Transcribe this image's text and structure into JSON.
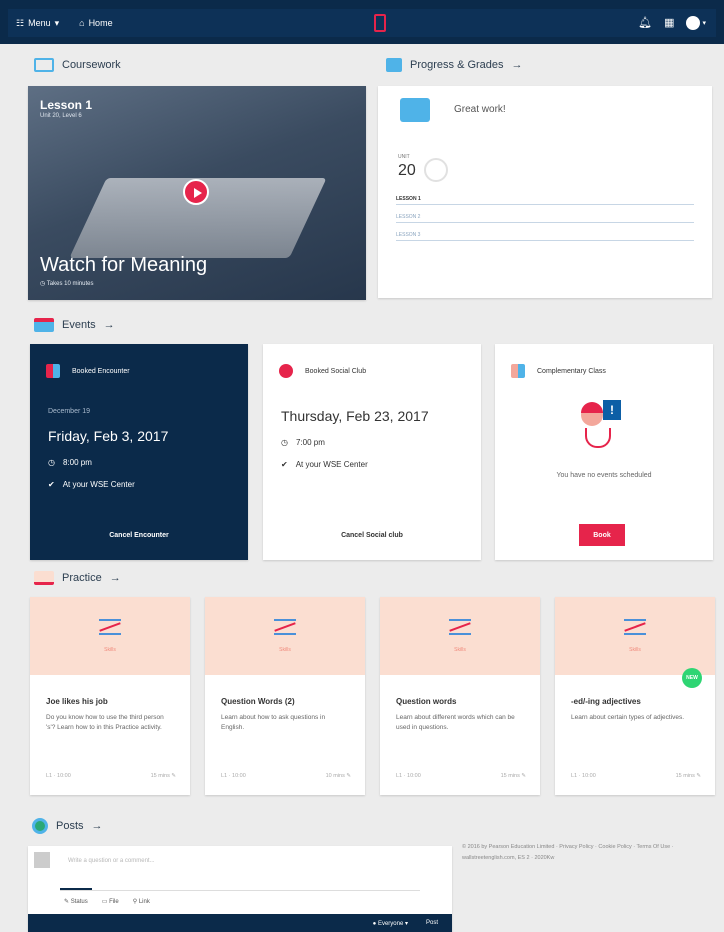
{
  "topbar": {
    "menu": "Menu",
    "home": "Home"
  },
  "sections": {
    "coursework": "Coursework",
    "progress": "Progress & Grades",
    "events": "Events",
    "practice": "Practice",
    "posts": "Posts"
  },
  "coursework": {
    "lesson": "Lesson 1",
    "unit_line": "Unit 20, Level 6",
    "title": "Watch for Meaning",
    "duration": "Takes 10 minutes"
  },
  "progress": {
    "message": "Great work!",
    "unit_label": "UNIT",
    "unit_number": "20",
    "lessons": [
      "LESSON 1",
      "LESSON 2",
      "LESSON 3"
    ]
  },
  "events": [
    {
      "name": "Booked Encounter",
      "date_small": "December 19",
      "date": "Friday, Feb 3, 2017",
      "time": "8:00 pm",
      "location": "At your WSE Center",
      "action": "Cancel Encounter"
    },
    {
      "name": "Booked Social Club",
      "date": "Thursday, Feb 23, 2017",
      "time": "7:00 pm",
      "location": "At your WSE Center",
      "action": "Cancel Social club"
    },
    {
      "name": "Complementary Class",
      "message": "You have no events scheduled",
      "action": "Book"
    }
  ],
  "practice": [
    {
      "sub": "Skills",
      "title": "Joe likes his job",
      "desc": "Do you know how to use the third person 's'? Learn how to in this Practice activity.",
      "meta": "L1 · 10:00",
      "time": "15 mins"
    },
    {
      "sub": "Skills",
      "title": "Question Words (2)",
      "desc": "Learn about how to ask questions in English.",
      "meta": "L1 · 10:00",
      "time": "10 mins"
    },
    {
      "sub": "Skills",
      "title": "Question words",
      "desc": "Learn about different words which can be used in questions.",
      "meta": "L1 · 10:00",
      "time": "15 mins"
    },
    {
      "sub": "Skills",
      "title": "-ed/-ing adjectives",
      "desc": "Learn about certain types of adjectives.",
      "meta": "L1 · 10:00",
      "time": "15 mins"
    }
  ],
  "practice_badge": "NEW",
  "posts": {
    "placeholder": "Write a question or a comment...",
    "tabs": [
      "Status",
      "File",
      "Link"
    ],
    "audience": "Everyone",
    "post_btn": "Post"
  },
  "footer": "© 2016 by Pearson Education Limited · Privacy Policy · Cookie Policy · Terms Of Use · wallstreetenglish.com, ES 2 · 2020Kw"
}
